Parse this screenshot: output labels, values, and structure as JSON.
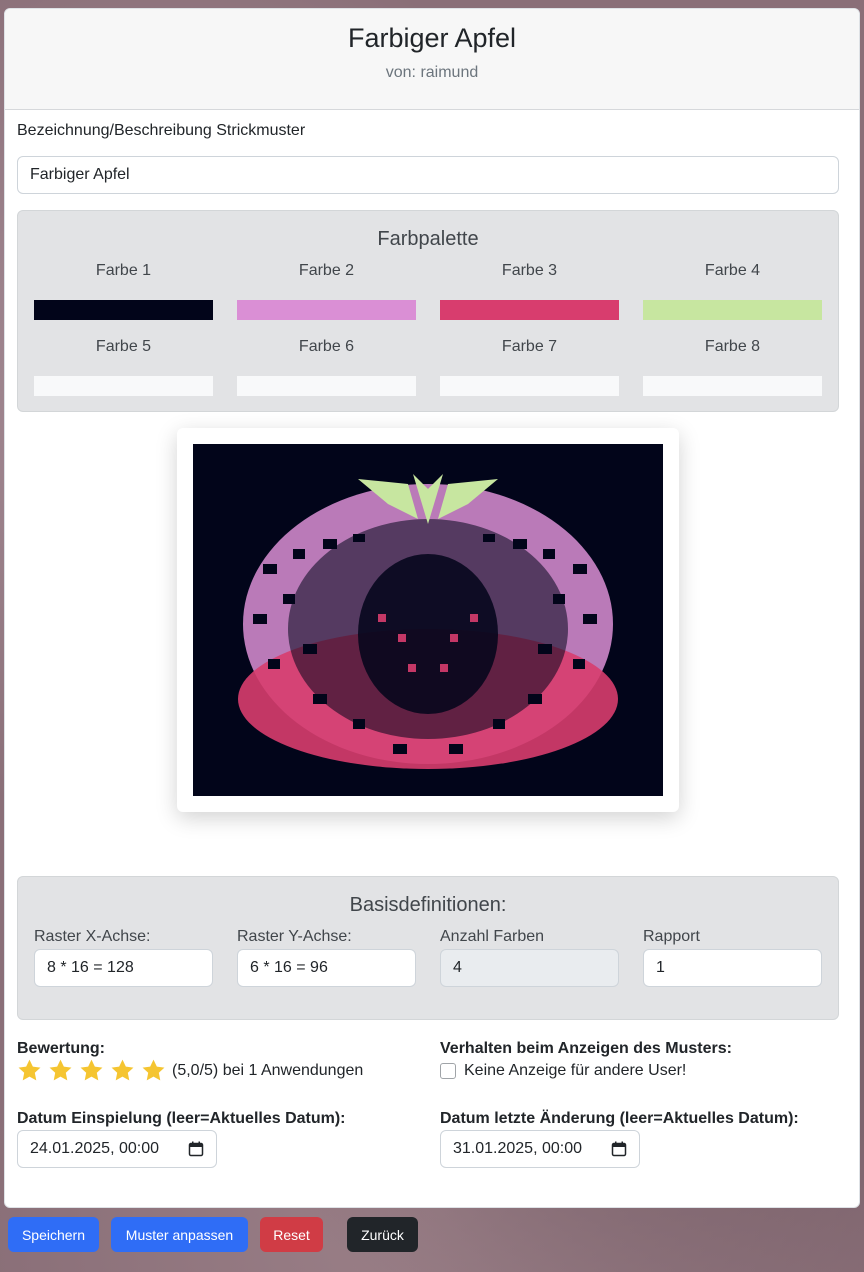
{
  "header": {
    "title": "Farbiger Apfel",
    "author": "von: raimund"
  },
  "description": {
    "label": "Bezeichnung/Beschreibung Strickmuster",
    "value": "Farbiger Apfel"
  },
  "palette": {
    "title": "Farbpalette",
    "colors": [
      {
        "label": "Farbe 1",
        "hex": "#02051a"
      },
      {
        "label": "Farbe 2",
        "hex": "#da8fd5"
      },
      {
        "label": "Farbe 3",
        "hex": "#d83d6e"
      },
      {
        "label": "Farbe 4",
        "hex": "#c7e6a0"
      },
      {
        "label": "Farbe 5",
        "hex": "#f8f9fa"
      },
      {
        "label": "Farbe 6",
        "hex": "#f8f9fa"
      },
      {
        "label": "Farbe 7",
        "hex": "#f8f9fa"
      },
      {
        "label": "Farbe 8",
        "hex": "#f8f9fa"
      }
    ]
  },
  "base": {
    "title": "Basisdefinitionen:",
    "fields": [
      {
        "label": "Raster X-Achse:",
        "value": "8 * 16 = 128"
      },
      {
        "label": "Raster Y-Achse:",
        "value": "6 * 16 = 96"
      },
      {
        "label": "Anzahl Farben",
        "value": "4"
      },
      {
        "label": "Rapport",
        "value": "1"
      }
    ]
  },
  "rating": {
    "label": "Bewertung:",
    "stars": 5,
    "text": "(5,0/5) bei 1 Anwendungen"
  },
  "display": {
    "label": "Verhalten beim Anzeigen des Musters:",
    "checkbox_label": "Keine Anzeige für andere User!",
    "checked": false
  },
  "dates": {
    "created_label": "Datum Einspielung (leer=Aktuelles Datum):",
    "created_value": "24.01.2025, 00:00",
    "modified_label": "Datum letzte Änderung (leer=Aktuelles Datum):",
    "modified_value": "31.01.2025, 00:00"
  },
  "buttons": {
    "save": "Speichern",
    "adjust": "Muster anpassen",
    "reset": "Reset",
    "back": "Zurück"
  },
  "colors": {
    "primary": "#2f6df6",
    "danger": "#d03c45",
    "dark": "#212529"
  }
}
